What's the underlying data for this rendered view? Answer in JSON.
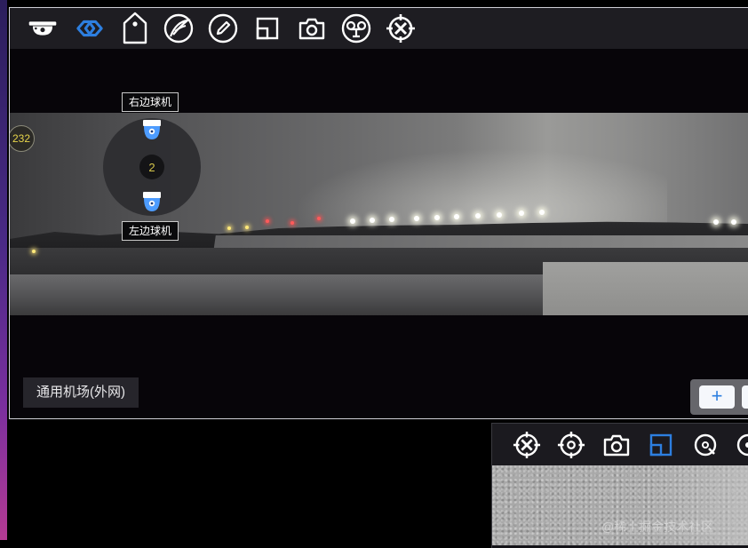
{
  "main_view": {
    "site_label": "通用机场(外网)",
    "zoom_in_label": "+",
    "panorama_badge": "232",
    "ptz_group": {
      "count": "2",
      "top_camera_label": "右边球机",
      "bottom_camera_label": "左边球机"
    },
    "toolbar_icons": [
      "dome-camera-icon",
      "link-icon",
      "tag-icon",
      "feather-icon",
      "pencil-icon",
      "window-icon",
      "camera-icon",
      "tape-recorder-icon",
      "target-crosshair-icon"
    ],
    "active_toolbar_icon": "link-icon"
  },
  "secondary_view": {
    "toolbar_icons": [
      "target-crosshair-icon",
      "target-icon",
      "camera-icon",
      "window-icon",
      "search-target-icon",
      "more-icon"
    ],
    "active_toolbar_icon": "window-icon"
  },
  "watermark": "@稀土掘金技术社区",
  "colors": {
    "accent_blue": "#2d7fe0",
    "badge_yellow": "#e6d44a",
    "toolbar_bg": "#1e1d22",
    "icon_white": "#ffffff"
  }
}
